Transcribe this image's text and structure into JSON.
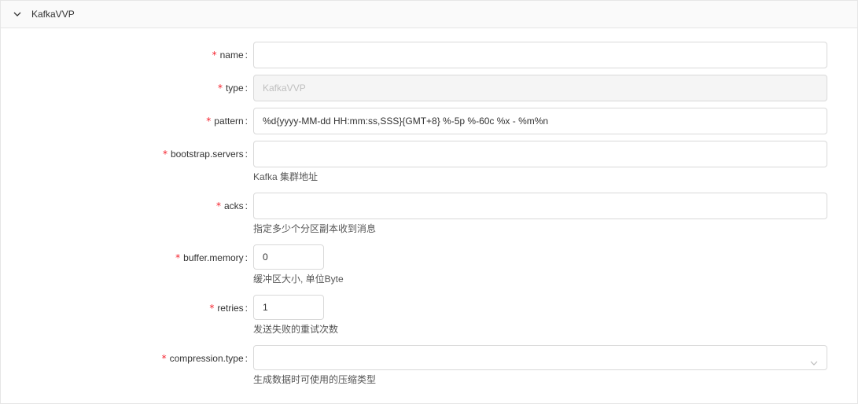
{
  "panel": {
    "title": "KafkaVVP"
  },
  "fields": {
    "name": {
      "label": "name",
      "value": ""
    },
    "type": {
      "label": "type",
      "value": "KafkaVVP"
    },
    "pattern": {
      "label": "pattern",
      "value": "%d{yyyy-MM-dd HH:mm:ss,SSS}{GMT+8} %-5p %-60c %x - %m%n"
    },
    "bootstrap_servers": {
      "label": "bootstrap.servers",
      "value": "",
      "help": "Kafka 集群地址"
    },
    "acks": {
      "label": "acks",
      "value": "",
      "help": "指定多少个分区副本收到消息"
    },
    "buffer_memory": {
      "label": "buffer.memory",
      "value": "0",
      "help": "缓冲区大小, 单位Byte"
    },
    "retries": {
      "label": "retries",
      "value": "1",
      "help": "发送失败的重试次数"
    },
    "compression_type": {
      "label": "compression.type",
      "value": "",
      "help": "生成数据时可使用的压缩类型"
    }
  },
  "colors": {
    "required": "#f5222d",
    "border": "#d9d9d9",
    "disabled_bg": "#f5f5f5"
  },
  "icons": {
    "collapse": "chevron-down-icon",
    "select": "chevron-down-icon"
  }
}
